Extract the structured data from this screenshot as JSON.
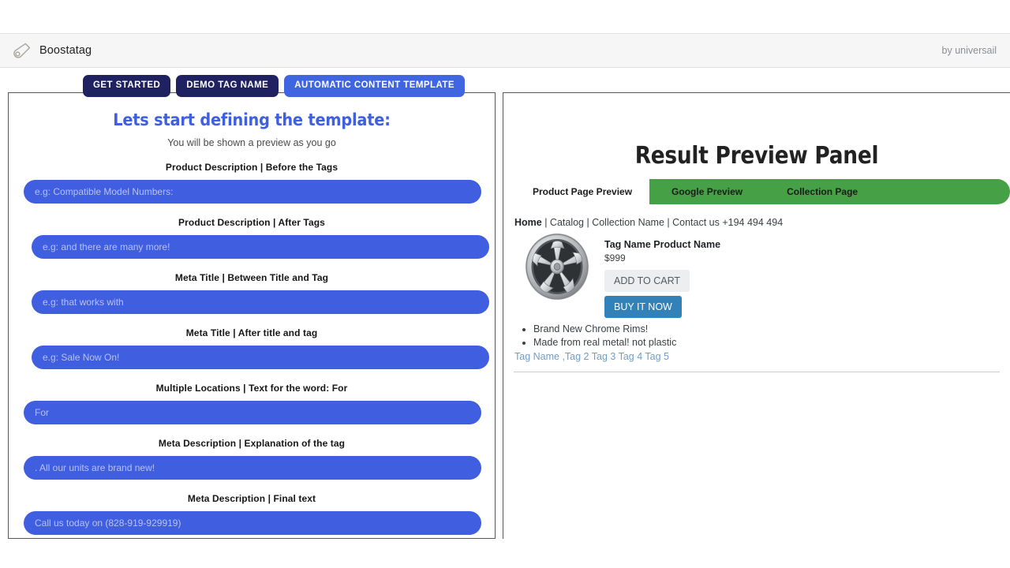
{
  "appbar": {
    "logo_icon": "tag-icon",
    "brand": "Boostatag",
    "byline": "by universail"
  },
  "nav": {
    "buttons": [
      {
        "label": "GET STARTED",
        "style": "dark"
      },
      {
        "label": "DEMO TAG NAME",
        "style": "dark"
      },
      {
        "label": "AUTOMATIC CONTENT TEMPLATE",
        "style": "bright"
      }
    ]
  },
  "form": {
    "title": "Lets start defining the template:",
    "subtitle": "You will be shown a preview as you go",
    "fields": [
      {
        "label": "Product Description | Before the Tags",
        "placeholder": "e.g: Compatible Model Numbers:",
        "value": ""
      },
      {
        "label": "Product Description | After Tags",
        "placeholder": "e.g: and there are many more!",
        "value": ""
      },
      {
        "label": "Meta Title | Between Title and Tag",
        "placeholder": "e.g: that works with",
        "value": ""
      },
      {
        "label": "Meta Title | After title and tag",
        "placeholder": "e.g: Sale Now On!",
        "value": ""
      },
      {
        "label": "Multiple Locations | Text for the word: For",
        "placeholder": "For",
        "value": ""
      },
      {
        "label": "Meta Description | Explanation of the tag",
        "placeholder": ". All our units are brand new!",
        "value": ""
      },
      {
        "label": "Meta Description | Final text",
        "placeholder": "Call us today on (828-919-929919)",
        "value": ""
      }
    ]
  },
  "preview": {
    "title": "Result Preview Panel",
    "tabs": [
      {
        "label": "Product Page Preview",
        "active": true
      },
      {
        "label": "Google Preview",
        "active": false
      },
      {
        "label": "Collection Page",
        "active": false
      }
    ],
    "breadcrumb_home": "Home",
    "breadcrumb_rest": " | Catalog | Collection Name | Contact us +194 494 494",
    "product": {
      "image_icon": "chrome-wheel-image",
      "name": "Tag Name Product Name",
      "price": "$999",
      "add_to_cart_label": "ADD TO CART",
      "buy_now_label": "BUY IT NOW",
      "bullets": [
        "Brand New Chrome Rims!",
        "Made from real metal! not plastic"
      ],
      "tags": "Tag Name ,Tag 2 Tag 3 Tag 4 Tag 5"
    }
  },
  "colors": {
    "accent_blue": "#3f5ee0",
    "nav_dark": "#1f2160",
    "nav_bright": "#4065e0",
    "tab_green": "#46a046",
    "buy_blue": "#3281b8",
    "link_blue": "#6f9ecb"
  }
}
